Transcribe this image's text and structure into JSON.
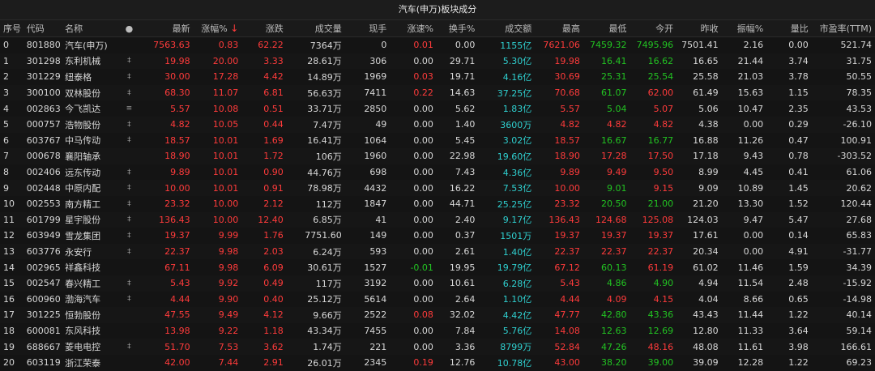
{
  "title": "汽车(申万)板块成分",
  "columns": {
    "idx": "序号",
    "code": "代码",
    "name": "名称",
    "flag": "●",
    "last": "最新",
    "pct": "涨幅%",
    "sort": "↓",
    "chg": "涨跌",
    "vol": "成交量",
    "cur": "现手",
    "speed": "涨速%",
    "turn": "换手%",
    "amount": "成交额",
    "high": "最高",
    "low": "最低",
    "open": "今开",
    "prev": "昨收",
    "amp": "振幅%",
    "vr": "量比",
    "pe": "市盈率(TTM)"
  },
  "rows": [
    {
      "idx": "0",
      "code": "801880",
      "name": "汽车(申万)",
      "flag": "",
      "last": "7563.63",
      "pct": "0.83",
      "chg": "62.22",
      "vol": "7364万",
      "cur": "0",
      "speed": "0.01",
      "turn": "0.00",
      "amount": "1155亿",
      "high": "7621.06",
      "low": "7459.32",
      "open": "7495.96",
      "prev": "7501.41",
      "amp": "2.16",
      "vr": "0.00",
      "pe": "521.74",
      "c_last": "red",
      "c_chg": "red",
      "c_speed": "red",
      "c_high": "red",
      "c_low": "green",
      "c_open": "green"
    },
    {
      "idx": "1",
      "code": "301298",
      "name": "东利机械",
      "flag": "‡",
      "last": "19.98",
      "pct": "20.00",
      "chg": "3.33",
      "vol": "28.61万",
      "cur": "306",
      "speed": "0.00",
      "turn": "29.71",
      "amount": "5.30亿",
      "high": "19.98",
      "low": "16.41",
      "open": "16.62",
      "prev": "16.65",
      "amp": "21.44",
      "vr": "3.74",
      "pe": "31.75",
      "c_last": "red",
      "c_chg": "red",
      "c_speed": "white",
      "c_high": "red",
      "c_low": "green",
      "c_open": "green"
    },
    {
      "idx": "2",
      "code": "301229",
      "name": "纽泰格",
      "flag": "‡",
      "last": "30.00",
      "pct": "17.28",
      "chg": "4.42",
      "vol": "14.89万",
      "cur": "1969",
      "speed": "0.03",
      "turn": "19.71",
      "amount": "4.16亿",
      "high": "30.69",
      "low": "25.31",
      "open": "25.54",
      "prev": "25.58",
      "amp": "21.03",
      "vr": "3.78",
      "pe": "50.55",
      "c_last": "red",
      "c_chg": "red",
      "c_speed": "red",
      "c_high": "red",
      "c_low": "green",
      "c_open": "green"
    },
    {
      "idx": "3",
      "code": "300100",
      "name": "双林股份",
      "flag": "‡",
      "last": "68.30",
      "pct": "11.07",
      "chg": "6.81",
      "vol": "56.63万",
      "cur": "7411",
      "speed": "0.22",
      "turn": "14.63",
      "amount": "37.25亿",
      "high": "70.68",
      "low": "61.07",
      "open": "62.00",
      "prev": "61.49",
      "amp": "15.63",
      "vr": "1.15",
      "pe": "78.35",
      "c_last": "red",
      "c_chg": "red",
      "c_speed": "red",
      "c_high": "red",
      "c_low": "green",
      "c_open": "red"
    },
    {
      "idx": "4",
      "code": "002863",
      "name": "今飞凯达",
      "flag": "≡",
      "last": "5.57",
      "pct": "10.08",
      "chg": "0.51",
      "vol": "33.71万",
      "cur": "2850",
      "speed": "0.00",
      "turn": "5.62",
      "amount": "1.83亿",
      "high": "5.57",
      "low": "5.04",
      "open": "5.07",
      "prev": "5.06",
      "amp": "10.47",
      "vr": "2.35",
      "pe": "43.53",
      "c_last": "red",
      "c_chg": "red",
      "c_speed": "white",
      "c_high": "red",
      "c_low": "green",
      "c_open": "red"
    },
    {
      "idx": "5",
      "code": "000757",
      "name": "浩物股份",
      "flag": "‡",
      "last": "4.82",
      "pct": "10.05",
      "chg": "0.44",
      "vol": "7.47万",
      "cur": "49",
      "speed": "0.00",
      "turn": "1.40",
      "amount": "3600万",
      "high": "4.82",
      "low": "4.82",
      "open": "4.82",
      "prev": "4.38",
      "amp": "0.00",
      "vr": "0.29",
      "pe": "-26.10",
      "c_last": "red",
      "c_chg": "red",
      "c_speed": "white",
      "c_high": "red",
      "c_low": "red",
      "c_open": "red"
    },
    {
      "idx": "6",
      "code": "603767",
      "name": "中马传动",
      "flag": "‡",
      "last": "18.57",
      "pct": "10.01",
      "chg": "1.69",
      "vol": "16.41万",
      "cur": "1064",
      "speed": "0.00",
      "turn": "5.45",
      "amount": "3.02亿",
      "high": "18.57",
      "low": "16.67",
      "open": "16.77",
      "prev": "16.88",
      "amp": "11.26",
      "vr": "0.47",
      "pe": "100.91",
      "c_last": "red",
      "c_chg": "red",
      "c_speed": "white",
      "c_high": "red",
      "c_low": "green",
      "c_open": "green"
    },
    {
      "idx": "7",
      "code": "000678",
      "name": "襄阳轴承",
      "flag": "",
      "last": "18.90",
      "pct": "10.01",
      "chg": "1.72",
      "vol": "106万",
      "cur": "1960",
      "speed": "0.00",
      "turn": "22.98",
      "amount": "19.60亿",
      "high": "18.90",
      "low": "17.28",
      "open": "17.50",
      "prev": "17.18",
      "amp": "9.43",
      "vr": "0.78",
      "pe": "-303.52",
      "c_last": "red",
      "c_chg": "red",
      "c_speed": "white",
      "c_high": "red",
      "c_low": "red",
      "c_open": "red"
    },
    {
      "idx": "8",
      "code": "002406",
      "name": "远东传动",
      "flag": "‡",
      "last": "9.89",
      "pct": "10.01",
      "chg": "0.90",
      "vol": "44.76万",
      "cur": "698",
      "speed": "0.00",
      "turn": "7.43",
      "amount": "4.36亿",
      "high": "9.89",
      "low": "9.49",
      "open": "9.50",
      "prev": "8.99",
      "amp": "4.45",
      "vr": "0.41",
      "pe": "61.06",
      "c_last": "red",
      "c_chg": "red",
      "c_speed": "white",
      "c_high": "red",
      "c_low": "red",
      "c_open": "red"
    },
    {
      "idx": "9",
      "code": "002448",
      "name": "中原内配",
      "flag": "‡",
      "last": "10.00",
      "pct": "10.01",
      "chg": "0.91",
      "vol": "78.98万",
      "cur": "4432",
      "speed": "0.00",
      "turn": "16.22",
      "amount": "7.53亿",
      "high": "10.00",
      "low": "9.01",
      "open": "9.15",
      "prev": "9.09",
      "amp": "10.89",
      "vr": "1.45",
      "pe": "20.62",
      "c_last": "red",
      "c_chg": "red",
      "c_speed": "white",
      "c_high": "red",
      "c_low": "green",
      "c_open": "red"
    },
    {
      "idx": "10",
      "code": "002553",
      "name": "南方精工",
      "flag": "‡",
      "last": "23.32",
      "pct": "10.00",
      "chg": "2.12",
      "vol": "112万",
      "cur": "1847",
      "speed": "0.00",
      "turn": "44.71",
      "amount": "25.25亿",
      "high": "23.32",
      "low": "20.50",
      "open": "21.00",
      "prev": "21.20",
      "amp": "13.30",
      "vr": "1.52",
      "pe": "120.44",
      "c_last": "red",
      "c_chg": "red",
      "c_speed": "white",
      "c_high": "red",
      "c_low": "green",
      "c_open": "green"
    },
    {
      "idx": "11",
      "code": "601799",
      "name": "星宇股份",
      "flag": "‡",
      "last": "136.43",
      "pct": "10.00",
      "chg": "12.40",
      "vol": "6.85万",
      "cur": "41",
      "speed": "0.00",
      "turn": "2.40",
      "amount": "9.17亿",
      "high": "136.43",
      "low": "124.68",
      "open": "125.08",
      "prev": "124.03",
      "amp": "9.47",
      "vr": "5.47",
      "pe": "27.68",
      "c_last": "red",
      "c_chg": "red",
      "c_speed": "white",
      "c_high": "red",
      "c_low": "red",
      "c_open": "red"
    },
    {
      "idx": "12",
      "code": "603949",
      "name": "雪龙集团",
      "flag": "‡",
      "last": "19.37",
      "pct": "9.99",
      "chg": "1.76",
      "vol": "7751.60",
      "cur": "149",
      "speed": "0.00",
      "turn": "0.37",
      "amount": "1501万",
      "high": "19.37",
      "low": "19.37",
      "open": "19.37",
      "prev": "17.61",
      "amp": "0.00",
      "vr": "0.14",
      "pe": "65.83",
      "c_last": "red",
      "c_chg": "red",
      "c_speed": "white",
      "c_high": "red",
      "c_low": "red",
      "c_open": "red"
    },
    {
      "idx": "13",
      "code": "603776",
      "name": "永安行",
      "flag": "‡",
      "last": "22.37",
      "pct": "9.98",
      "chg": "2.03",
      "vol": "6.24万",
      "cur": "593",
      "speed": "0.00",
      "turn": "2.61",
      "amount": "1.40亿",
      "high": "22.37",
      "low": "22.37",
      "open": "22.37",
      "prev": "20.34",
      "amp": "0.00",
      "vr": "4.91",
      "pe": "-31.77",
      "c_last": "red",
      "c_chg": "red",
      "c_speed": "white",
      "c_high": "red",
      "c_low": "red",
      "c_open": "red"
    },
    {
      "idx": "14",
      "code": "002965",
      "name": "祥鑫科技",
      "flag": "",
      "last": "67.11",
      "pct": "9.98",
      "chg": "6.09",
      "vol": "30.61万",
      "cur": "1527",
      "speed": "-0.01",
      "turn": "19.95",
      "amount": "19.79亿",
      "high": "67.12",
      "low": "60.13",
      "open": "61.19",
      "prev": "61.02",
      "amp": "11.46",
      "vr": "1.59",
      "pe": "34.39",
      "c_last": "red",
      "c_chg": "red",
      "c_speed": "green",
      "c_high": "red",
      "c_low": "green",
      "c_open": "red"
    },
    {
      "idx": "15",
      "code": "002547",
      "name": "春兴精工",
      "flag": "‡",
      "last": "5.43",
      "pct": "9.92",
      "chg": "0.49",
      "vol": "117万",
      "cur": "3192",
      "speed": "0.00",
      "turn": "10.61",
      "amount": "6.28亿",
      "high": "5.43",
      "low": "4.86",
      "open": "4.90",
      "prev": "4.94",
      "amp": "11.54",
      "vr": "2.48",
      "pe": "-15.92",
      "c_last": "red",
      "c_chg": "red",
      "c_speed": "white",
      "c_high": "red",
      "c_low": "green",
      "c_open": "green"
    },
    {
      "idx": "16",
      "code": "600960",
      "name": "渤海汽车",
      "flag": "‡",
      "last": "4.44",
      "pct": "9.90",
      "chg": "0.40",
      "vol": "25.12万",
      "cur": "5614",
      "speed": "0.00",
      "turn": "2.64",
      "amount": "1.10亿",
      "high": "4.44",
      "low": "4.09",
      "open": "4.15",
      "prev": "4.04",
      "amp": "8.66",
      "vr": "0.65",
      "pe": "-14.98",
      "c_last": "red",
      "c_chg": "red",
      "c_speed": "white",
      "c_high": "red",
      "c_low": "red",
      "c_open": "red"
    },
    {
      "idx": "17",
      "code": "301225",
      "name": "恒勃股份",
      "flag": "",
      "last": "47.55",
      "pct": "9.49",
      "chg": "4.12",
      "vol": "9.66万",
      "cur": "2522",
      "speed": "0.08",
      "turn": "32.02",
      "amount": "4.42亿",
      "high": "47.77",
      "low": "42.80",
      "open": "43.36",
      "prev": "43.43",
      "amp": "11.44",
      "vr": "1.22",
      "pe": "40.14",
      "c_last": "red",
      "c_chg": "red",
      "c_speed": "red",
      "c_high": "red",
      "c_low": "green",
      "c_open": "green"
    },
    {
      "idx": "18",
      "code": "600081",
      "name": "东风科技",
      "flag": "",
      "last": "13.98",
      "pct": "9.22",
      "chg": "1.18",
      "vol": "43.34万",
      "cur": "7455",
      "speed": "0.00",
      "turn": "7.84",
      "amount": "5.76亿",
      "high": "14.08",
      "low": "12.63",
      "open": "12.69",
      "prev": "12.80",
      "amp": "11.33",
      "vr": "3.64",
      "pe": "59.14",
      "c_last": "red",
      "c_chg": "red",
      "c_speed": "white",
      "c_high": "red",
      "c_low": "green",
      "c_open": "green"
    },
    {
      "idx": "19",
      "code": "688667",
      "name": "菱电电控",
      "flag": "‡",
      "last": "51.70",
      "pct": "7.53",
      "chg": "3.62",
      "vol": "1.74万",
      "cur": "221",
      "speed": "0.00",
      "turn": "3.36",
      "amount": "8799万",
      "high": "52.84",
      "low": "47.26",
      "open": "48.16",
      "prev": "48.08",
      "amp": "11.61",
      "vr": "3.98",
      "pe": "166.61",
      "c_last": "red",
      "c_chg": "red",
      "c_speed": "white",
      "c_high": "red",
      "c_low": "green",
      "c_open": "red"
    },
    {
      "idx": "20",
      "code": "603119",
      "name": "浙江荣泰",
      "flag": "",
      "last": "42.00",
      "pct": "7.44",
      "chg": "2.91",
      "vol": "26.01万",
      "cur": "2345",
      "speed": "0.19",
      "turn": "12.76",
      "amount": "10.78亿",
      "high": "43.00",
      "low": "38.20",
      "open": "39.00",
      "prev": "39.09",
      "amp": "12.28",
      "vr": "1.22",
      "pe": "69.23",
      "c_last": "red",
      "c_chg": "red",
      "c_speed": "red",
      "c_high": "red",
      "c_low": "green",
      "c_open": "green"
    }
  ]
}
